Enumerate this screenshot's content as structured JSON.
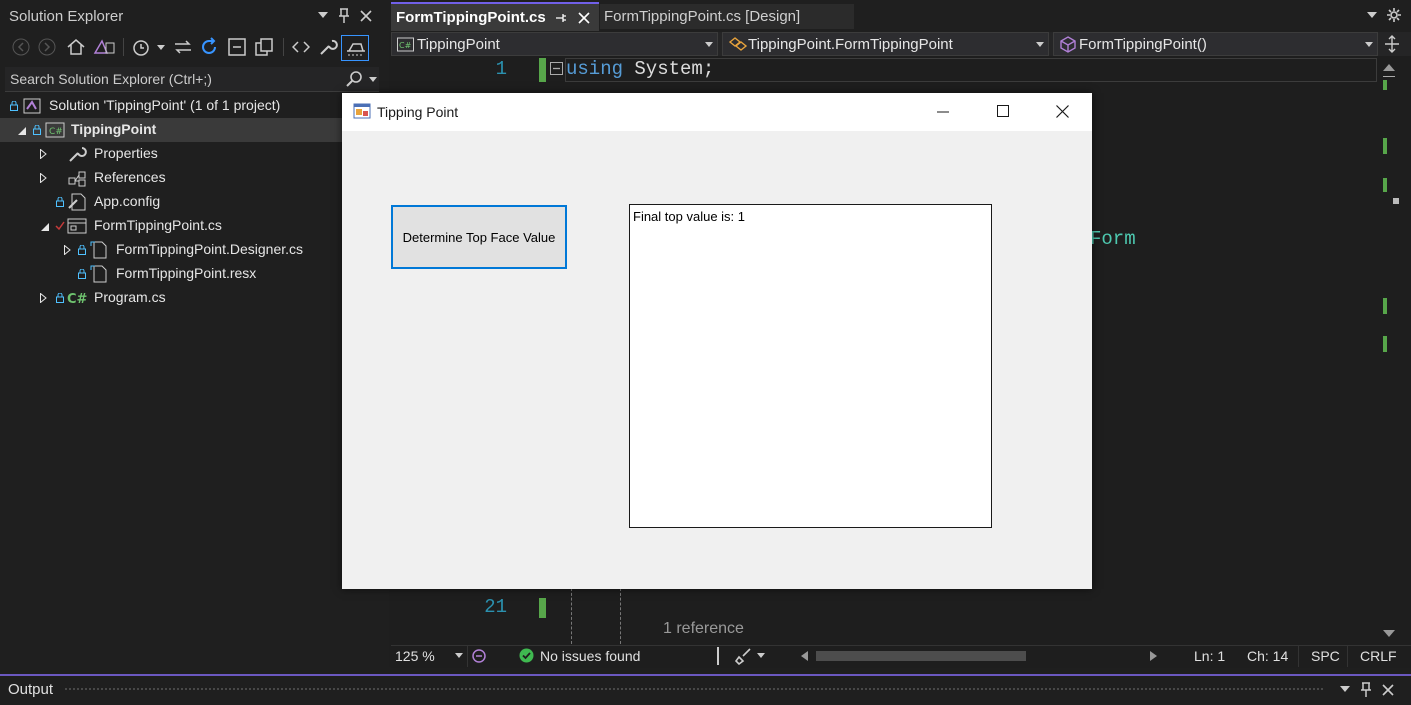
{
  "solution_explorer": {
    "title": "Solution Explorer",
    "search_placeholder": "Search Solution Explorer (Ctrl+;)",
    "tree": [
      {
        "label": "Solution 'TippingPoint' (1 of 1 project)"
      },
      {
        "label": "TippingPoint"
      },
      {
        "label": "Properties"
      },
      {
        "label": "References"
      },
      {
        "label": "App.config"
      },
      {
        "label": "FormTippingPoint.cs"
      },
      {
        "label": "FormTippingPoint.Designer.cs"
      },
      {
        "label": "FormTippingPoint.resx"
      },
      {
        "label": "Program.cs"
      }
    ]
  },
  "editor": {
    "tabs": [
      {
        "label": "FormTippingPoint.cs"
      },
      {
        "label": "FormTippingPoint.cs [Design]"
      }
    ],
    "nav": {
      "project": "TippingPoint",
      "class": "TippingPoint.FormTippingPoint",
      "member": "FormTippingPoint()"
    },
    "line1_number": "1",
    "line1_keyword": "using",
    "line1_rest": " System;",
    "line21_number": "21",
    "peek_text": "Form",
    "codelens": "1 reference",
    "status": {
      "zoom": "125 %",
      "issues": "No issues found",
      "ln": "Ln: 1",
      "ch": "Ch: 14",
      "spc": "SPC",
      "crlf": "CRLF"
    }
  },
  "output": {
    "title": "Output"
  },
  "form": {
    "title": "Tipping Point",
    "button_label": "Determine Top Face Value",
    "output_text": "Final top value is: 1"
  }
}
